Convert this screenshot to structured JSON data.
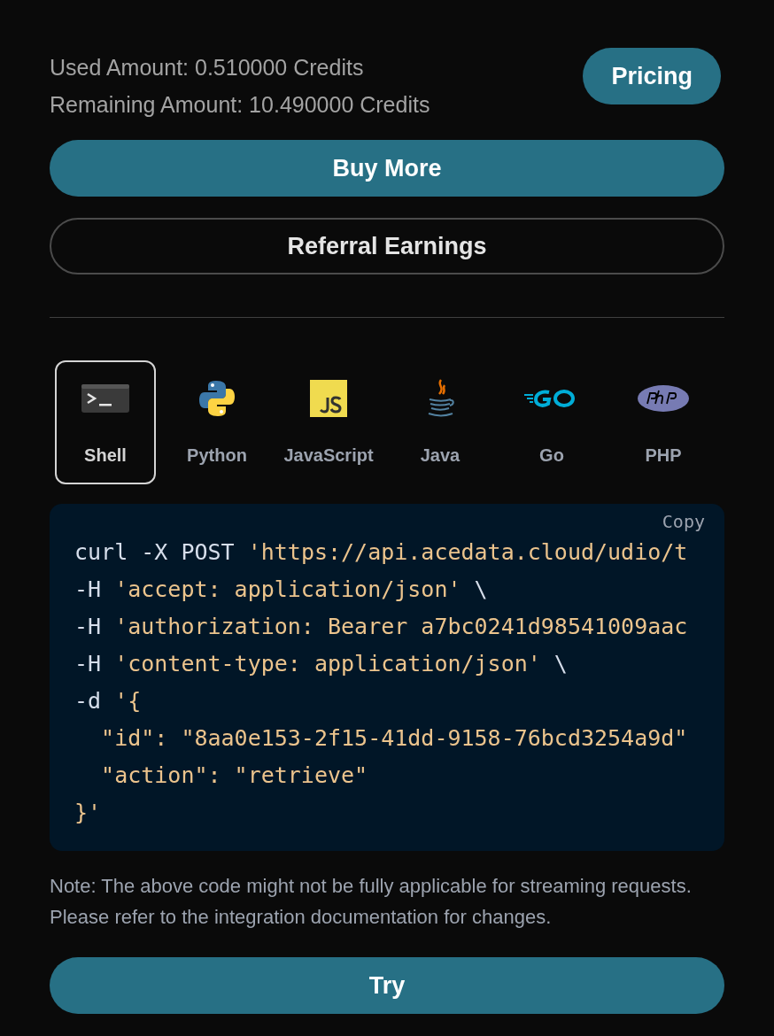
{
  "usage": {
    "used": "Used Amount: 0.510000 Credits",
    "remaining": "Remaining Amount: 10.490000 Credits",
    "pricing_button": "Pricing"
  },
  "buttons": [
    {
      "label": "Buy More",
      "kind": "primary"
    },
    {
      "label": "Referral Earnings",
      "kind": "outline"
    }
  ],
  "language_tabs": [
    {
      "label": "Shell",
      "selected": true
    },
    {
      "label": "Python",
      "selected": false
    },
    {
      "label": "JavaScript",
      "selected": false
    },
    {
      "label": "Java",
      "selected": false
    },
    {
      "label": "Go",
      "selected": false
    },
    {
      "label": "PHP",
      "selected": false
    }
  ],
  "code": {
    "copy_button": "Copy",
    "lines": [
      [
        {
          "kind": "plain",
          "text": "curl -X POST "
        },
        {
          "kind": "string",
          "text": "'https://api.acedata.cloud/udio/t"
        }
      ],
      [
        {
          "kind": "plain",
          "text": "-H "
        },
        {
          "kind": "string",
          "text": "'accept: application/json'"
        },
        {
          "kind": "plain",
          "text": " \\"
        }
      ],
      [
        {
          "kind": "plain",
          "text": "-H "
        },
        {
          "kind": "string",
          "text": "'authorization: Bearer a7bc0241d98541009aac"
        }
      ],
      [
        {
          "kind": "plain",
          "text": "-H "
        },
        {
          "kind": "string",
          "text": "'content-type: application/json'"
        },
        {
          "kind": "plain",
          "text": " \\"
        }
      ],
      [
        {
          "kind": "plain",
          "text": "-d "
        },
        {
          "kind": "string",
          "text": "'{"
        }
      ],
      [
        {
          "kind": "string",
          "text": "  \"id\": \"8aa0e153-2f15-41dd-9158-76bcd3254a9d\""
        }
      ],
      [
        {
          "kind": "string",
          "text": "  \"action\": \"retrieve\""
        }
      ],
      [
        {
          "kind": "string",
          "text": "}'"
        }
      ]
    ]
  },
  "note": "Note: The above code might not be fully applicable for streaming requests. Please refer to the integration documentation for changes.",
  "try_button": "Try"
}
